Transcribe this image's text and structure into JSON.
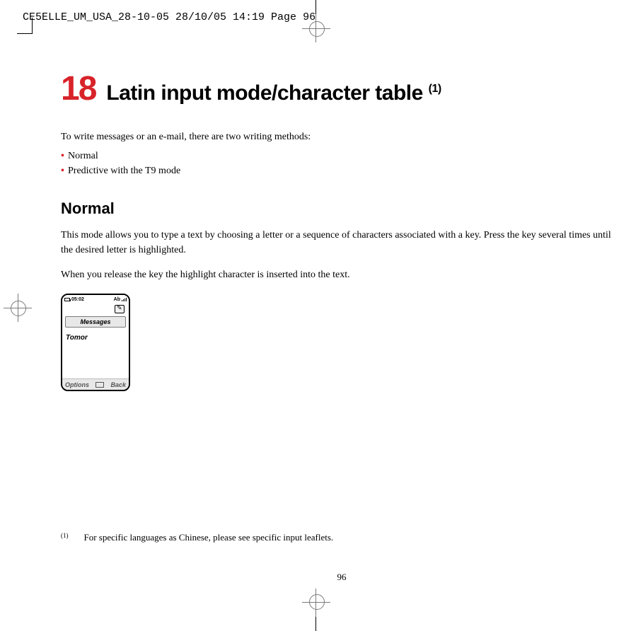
{
  "header": "CE5ELLE_UM_USA_28-10-05  28/10/05  14:19  Page 96",
  "chapter": {
    "number": "18",
    "title": "Latin input mode/character table",
    "super": "(1)"
  },
  "intro": "To write messages or an e-mail, there are two writing methods:",
  "bullets": [
    "Normal",
    "Predictive with the T9 mode"
  ],
  "section": {
    "heading": "Normal",
    "para1": "This mode allows you to type a text by choosing a letter or a sequence of characters associated with a key. Press the key several times until the desired letter is highlighted.",
    "para2": "When you release the key the highlight character is inserted into the text."
  },
  "phone": {
    "time": "05:02",
    "mode": "Ab",
    "title": "Messages",
    "typed": "Tomor",
    "left_softkey": "Options",
    "right_softkey": "Back"
  },
  "footnote": {
    "marker": "(1)",
    "text": "For specific languages as Chinese, please see specific input leaflets."
  },
  "page_number": "96"
}
